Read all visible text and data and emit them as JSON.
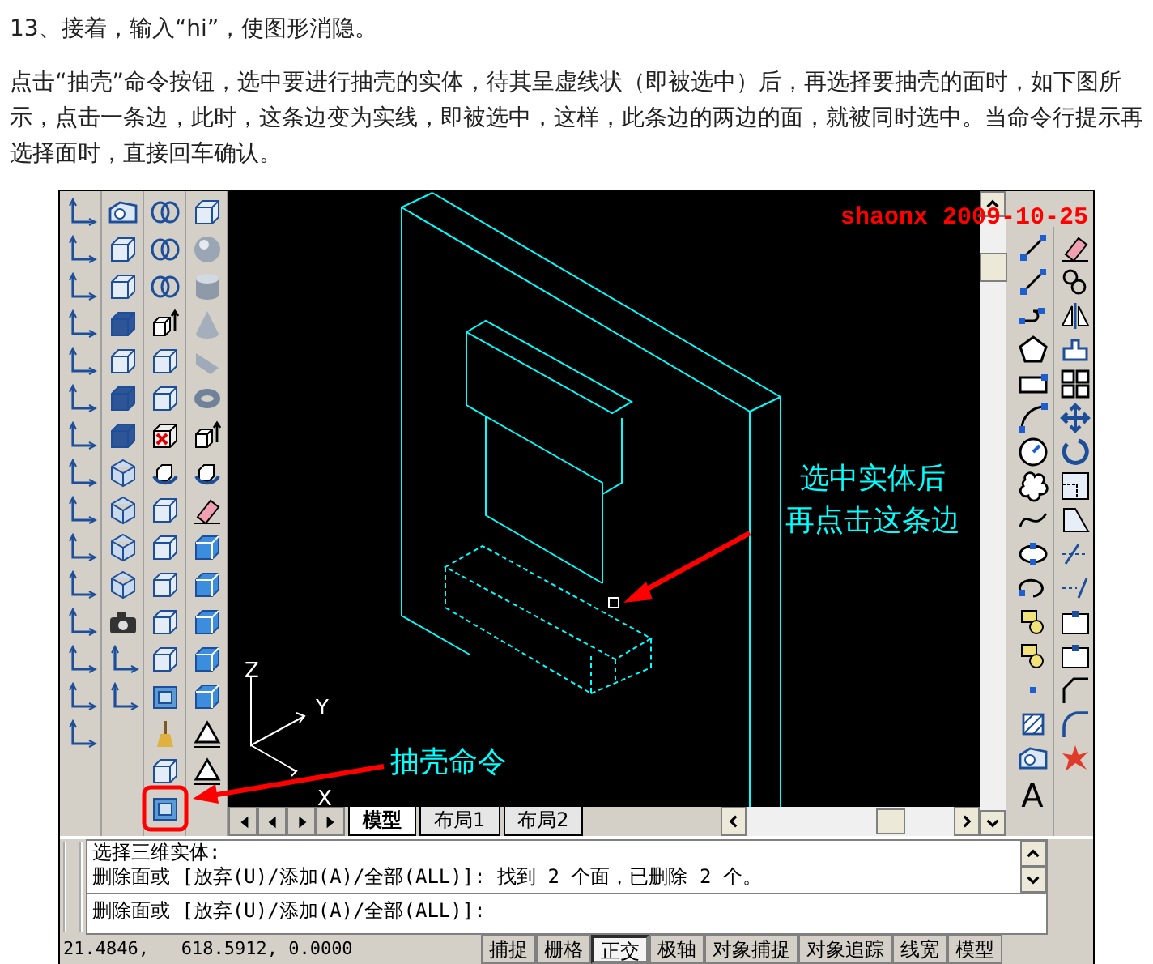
{
  "article": {
    "heading": "13、接着，输入“hi”，使图形消隐。",
    "paragraph": "点击“抽壳”命令按钮，选中要进行抽壳的实体，待其呈虚线状（即被选中）后，再选择要抽壳的面时，如下图所示，点击一条边，此时，这条边变为实线，即被选中，这样，此条边的两边的面，就被同时选中。当命令行提示再选择面时，直接回车确认。"
  },
  "cad_window": {
    "canvas": {
      "author_stamp": "shaonx 2009-10-25",
      "callout": [
        "选中实体后",
        "再点击这条边"
      ],
      "tool_label": "抽壳命令",
      "ucs_axes": [
        "Z",
        "Y",
        "X"
      ]
    },
    "layout_tabs": [
      {
        "label": "模型",
        "selected": true
      },
      {
        "label": "布局1",
        "selected": false
      },
      {
        "label": "布局2",
        "selected": false
      }
    ],
    "right_toolbar": {
      "text_tool": "A"
    },
    "command_line": {
      "history": [
        "选择三维实体:",
        "删除面或 [放弃(U)/添加(A)/全部(ALL)]: 找到 2 个面，已删除 2 个。"
      ],
      "prompt": "删除面或 [放弃(U)/添加(A)/全部(ALL)]:"
    },
    "status_bar": {
      "coordinates": "21.4846,   618.5912, 0.0000",
      "toggles": [
        {
          "label": "捕捉",
          "on": false
        },
        {
          "label": "栅格",
          "on": false
        },
        {
          "label": "正交",
          "on": true
        },
        {
          "label": "极轴",
          "on": false
        },
        {
          "label": "对象捕捉",
          "on": false
        },
        {
          "label": "对象追踪",
          "on": false
        },
        {
          "label": "线宽",
          "on": false
        },
        {
          "label": "模型",
          "on": false
        }
      ]
    }
  }
}
